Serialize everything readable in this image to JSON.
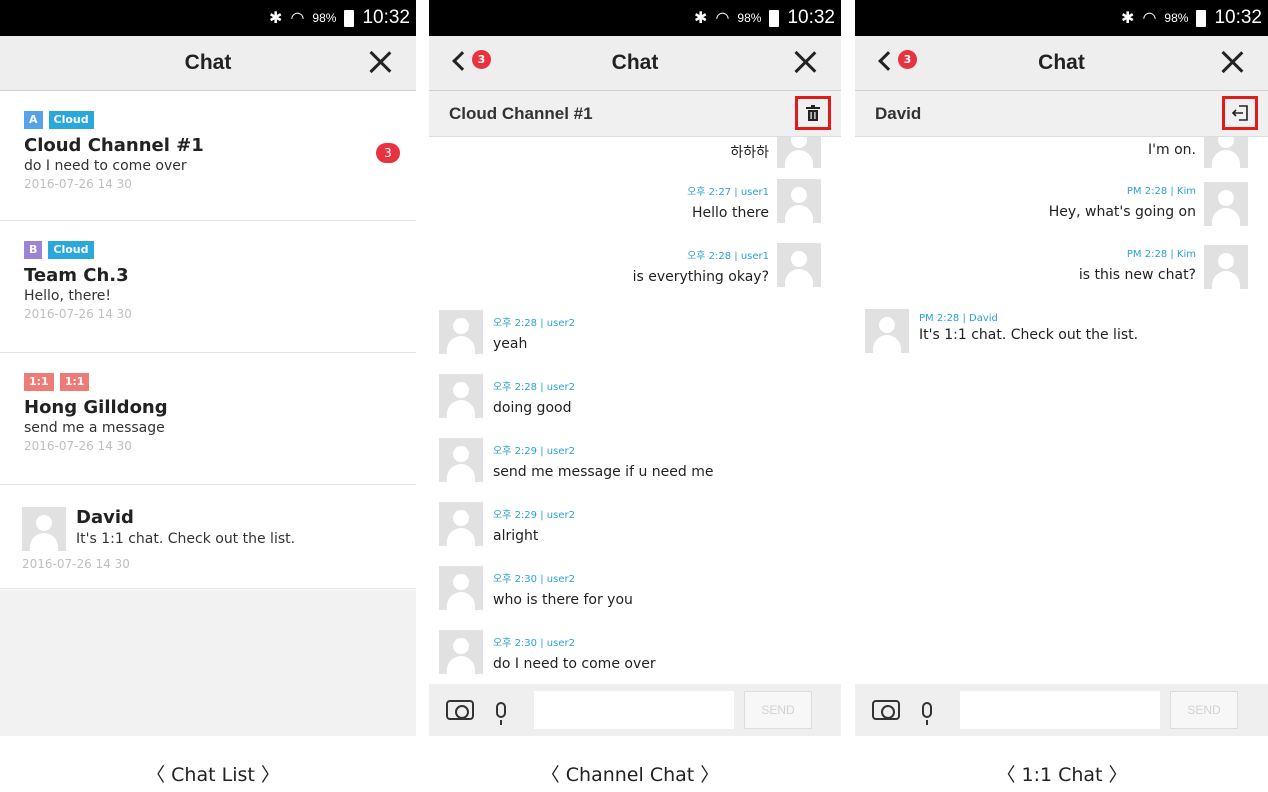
{
  "status": {
    "battery": "98%",
    "time": "10:32"
  },
  "chat_list": {
    "title": "Chat",
    "items": [
      {
        "tags": [
          "A",
          "Cloud"
        ],
        "name": "Cloud Channel #1",
        "preview": "do I need to come over",
        "time": "2016-07-26 14 30",
        "unread": "3"
      },
      {
        "tags": [
          "B",
          "Cloud"
        ],
        "name": "Team Ch.3",
        "preview": "Hello, there!",
        "time": "2016-07-26 14 30"
      },
      {
        "tags": [
          "1:1",
          "1:1"
        ],
        "name": "Hong Gilldong",
        "preview": "send me a message",
        "time": "2016-07-26 14 30"
      },
      {
        "name": "David",
        "preview": "It's 1:1 chat. Check out the list.",
        "time": "2016-07-26 14 30"
      }
    ]
  },
  "channel_chat": {
    "title": "Chat",
    "back_badge": "3",
    "channel_name": "Cloud Channel #1",
    "messages_right": [
      {
        "meta": "",
        "text": "하하하"
      },
      {
        "meta": "오후 2:27 | user1",
        "text": "Hello there"
      },
      {
        "meta": "오후 2:28 | user1",
        "text": "is everything okay?"
      }
    ],
    "messages_left": [
      {
        "meta": "오후 2:28 | user2",
        "text": "yeah"
      },
      {
        "meta": "오후 2:28 | user2",
        "text": "doing good"
      },
      {
        "meta": "오후 2:29 | user2",
        "text": "send me message if u need me"
      },
      {
        "meta": "오후 2:29 | user2",
        "text": "alright"
      },
      {
        "meta": "오후 2:30 | user2",
        "text": "who is there for you"
      },
      {
        "meta": "오후 2:30 | user2",
        "text": "do I need to come over"
      }
    ],
    "send_label": "SEND"
  },
  "one_on_one_chat": {
    "title": "Chat",
    "back_badge": "3",
    "partner_name": "David",
    "messages_right": [
      {
        "meta": "",
        "text": "I'm on."
      },
      {
        "meta": "PM 2:28 | Kim",
        "text": "Hey, what's going on"
      },
      {
        "meta": "PM 2:28 | Kim",
        "text": "is this new chat?"
      }
    ],
    "messages_left": [
      {
        "meta": "PM 2:28 | David",
        "text": "It's 1:1 chat. Check out the list."
      }
    ],
    "send_label": "SEND"
  },
  "captions": [
    "〈 Chat List 〉",
    "〈 Channel Chat 〉",
    "〈 1:1 Chat 〉"
  ],
  "icons": {
    "trash": "trash-icon",
    "exit": "exit-icon",
    "camera": "camera-icon",
    "mic": "mic-icon"
  },
  "colors": {
    "badge_red": "#e8323f",
    "highlight_red": "#e01b1b",
    "meta_blue": "#2aa0d8"
  }
}
